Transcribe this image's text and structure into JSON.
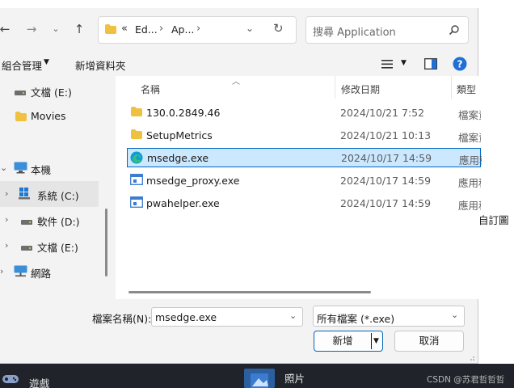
{
  "breadcrumb": {
    "overflow": "«",
    "seg1": "Ed...",
    "sep": "›",
    "seg2": "Ap...",
    "tail": "›"
  },
  "search": {
    "placeholder": "搜尋 Application"
  },
  "toolbar": {
    "organize_label": "組合管理",
    "new_folder_label": "新增資料夾"
  },
  "nav": {
    "items": [
      {
        "label": "文檔 (E:)"
      },
      {
        "label": "Movies"
      },
      {
        "label": "本機"
      },
      {
        "label": "系統 (C:)"
      },
      {
        "label": "軟件 (D:)"
      },
      {
        "label": "文檔 (E:)"
      },
      {
        "label": "網路"
      }
    ]
  },
  "columns": {
    "name": "名稱",
    "date": "修改日期",
    "type": "類型"
  },
  "files": [
    {
      "name": "130.0.2849.46",
      "date": "2024/10/21 7:52",
      "type": "檔案資料夾"
    },
    {
      "name": "SetupMetrics",
      "date": "2024/10/21 10:13",
      "type": "檔案資料夾"
    },
    {
      "name": "msedge.exe",
      "date": "2024/10/17 14:59",
      "type": "應用程式"
    },
    {
      "name": "msedge_proxy.exe",
      "date": "2024/10/17 14:59",
      "type": "應用程式"
    },
    {
      "name": "pwahelper.exe",
      "date": "2024/10/17 14:59",
      "type": "應用程式"
    }
  ],
  "footer": {
    "filename_label": "檔案名稱(N):",
    "filename_value": "msedge.exe",
    "filter_value": "所有檔案 (*.exe)",
    "open_label": "新增",
    "cancel_label": "取消"
  },
  "background": {
    "side_text": "自訂圖",
    "game_label": "遊戲",
    "photo_label": "照片",
    "watermark": "CSDN @苏君哲哲哲"
  },
  "colors": {
    "accent": "#0067c0",
    "selection": "#cce8ff",
    "folder": "#f0c040",
    "help": "#1f6fd6"
  }
}
